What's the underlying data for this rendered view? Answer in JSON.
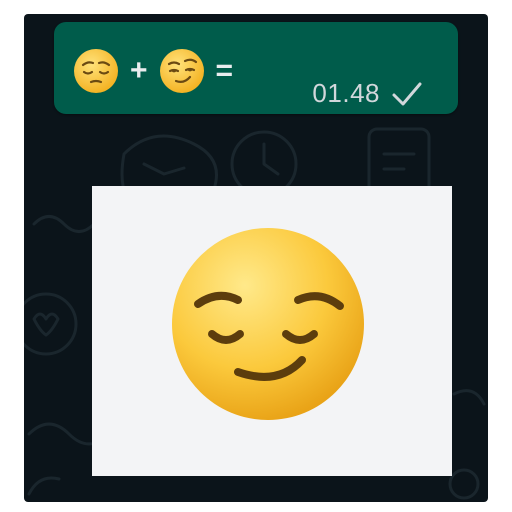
{
  "message": {
    "emoji_1": "pensive-face",
    "operator_plus": "+",
    "emoji_2": "smirking-face",
    "operator_equals": "=",
    "time": "01.48",
    "status_icon": "single-check"
  },
  "image": {
    "emoji": "relieved-smirk-face"
  },
  "colors": {
    "wallpaper": "#0b141a",
    "bubble": "#005c4b",
    "time_text": "#d1d7db",
    "panel": "#f3f4f6",
    "emoji_face": "#f9c93a"
  }
}
